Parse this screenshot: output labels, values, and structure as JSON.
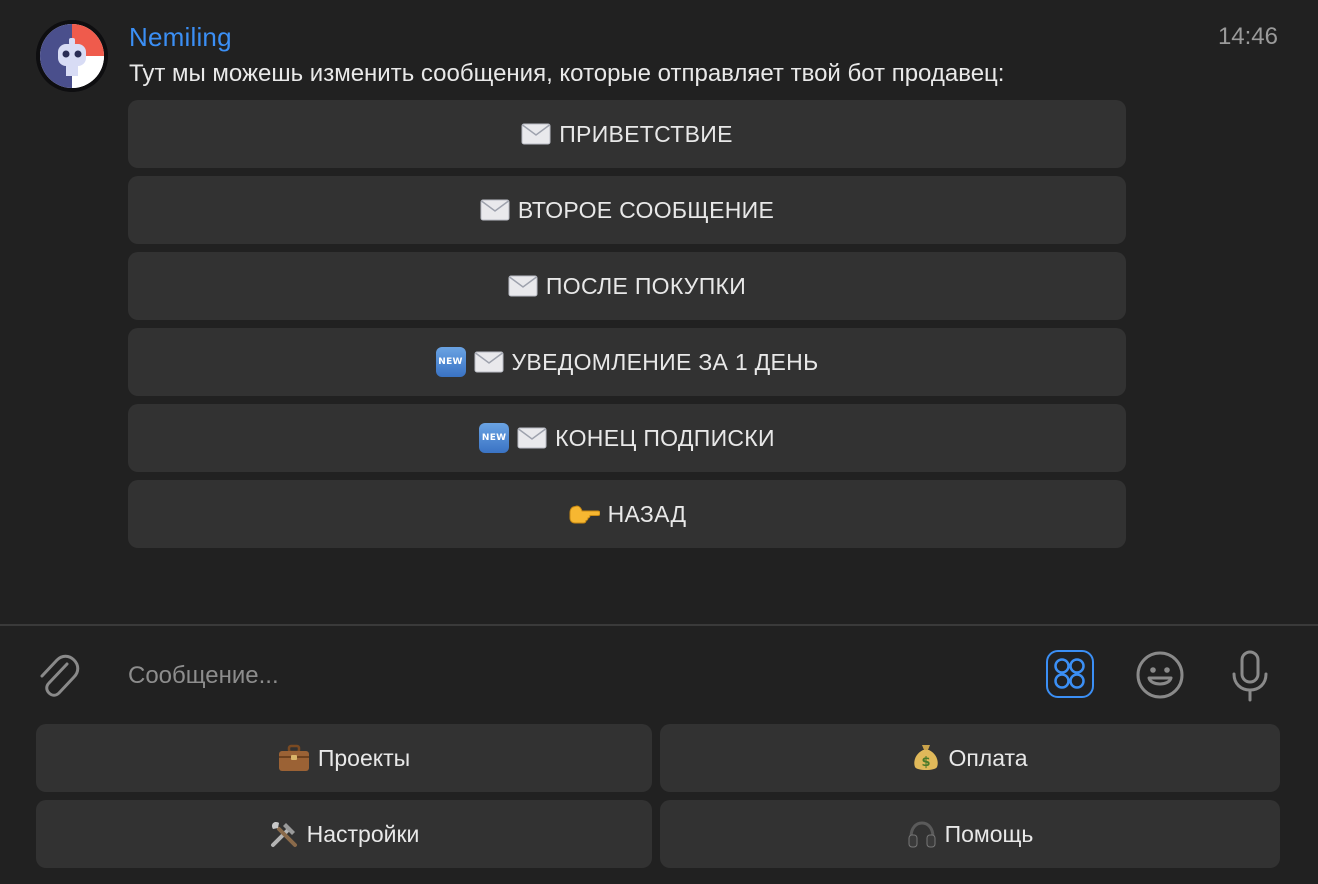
{
  "message": {
    "sender": "Nemiling",
    "time": "14:46",
    "text": "Тут мы можешь изменить сообщения, которые отправляет твой бот продавец:"
  },
  "inline_keyboard": [
    {
      "label": "ПРИВЕТСТВИЕ",
      "icons": [
        "envelope-icon"
      ]
    },
    {
      "label": "ВТОРОЕ СООБЩЕНИЕ",
      "icons": [
        "envelope-icon"
      ]
    },
    {
      "label": "ПОСЛЕ ПОКУПКИ",
      "icons": [
        "envelope-icon"
      ]
    },
    {
      "label": "УВЕДОМЛЕНИЕ ЗА 1 ДЕНЬ",
      "icons": [
        "new-badge-icon",
        "envelope-icon"
      ]
    },
    {
      "label": "КОНЕЦ ПОДПИСКИ",
      "icons": [
        "new-badge-icon",
        "envelope-icon"
      ]
    },
    {
      "label": "НАЗАД",
      "icons": [
        "pointing-hand-icon"
      ]
    }
  ],
  "new_badge_text": "NEW",
  "input": {
    "placeholder": "Сообщение..."
  },
  "reply_keyboard": [
    [
      {
        "label": "Проекты",
        "icon": "briefcase-icon"
      },
      {
        "label": "Оплата",
        "icon": "money-bag-icon"
      }
    ],
    [
      {
        "label": "Настройки",
        "icon": "tools-icon"
      },
      {
        "label": "Помощь",
        "icon": "headphones-icon"
      }
    ]
  ],
  "colors": {
    "background": "#212121",
    "button": "#323232",
    "accent": "#3b8ff5",
    "sender_name": "#3b8ff5",
    "muted_text": "#9a9a9a"
  }
}
